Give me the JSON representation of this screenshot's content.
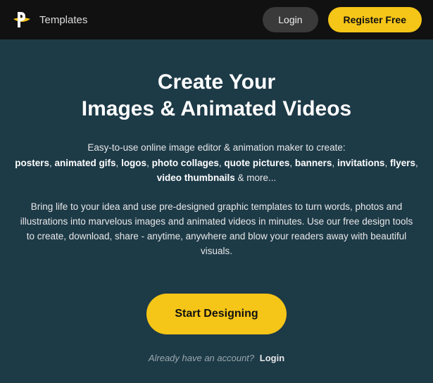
{
  "header": {
    "nav_templates": "Templates",
    "login": "Login",
    "register": "Register Free"
  },
  "hero": {
    "title_line1": "Create Your",
    "title_line2": "Images & Animated Videos",
    "tagline_intro": "Easy-to-use online image editor & animation maker to create:",
    "keywords": [
      "posters",
      "animated gifs",
      "logos",
      "photo collages",
      "quote pictures",
      "banners",
      "invitations",
      "flyers",
      "video thumbnails"
    ],
    "tagline_outro": "& more...",
    "description": "Bring life to your idea and use pre-designed graphic templates to turn words, photos and illustrations into marvelous images and animated videos in minutes. Use our free design tools to create, download, share - anytime, anywhere and blow your readers away with beautiful visuals.",
    "cta": "Start Designing",
    "login_prompt": "Already have an account?",
    "login_link": "Login"
  },
  "colors": {
    "accent": "#f5c518",
    "bg": "#1d3a47",
    "header_bg": "#111111"
  }
}
